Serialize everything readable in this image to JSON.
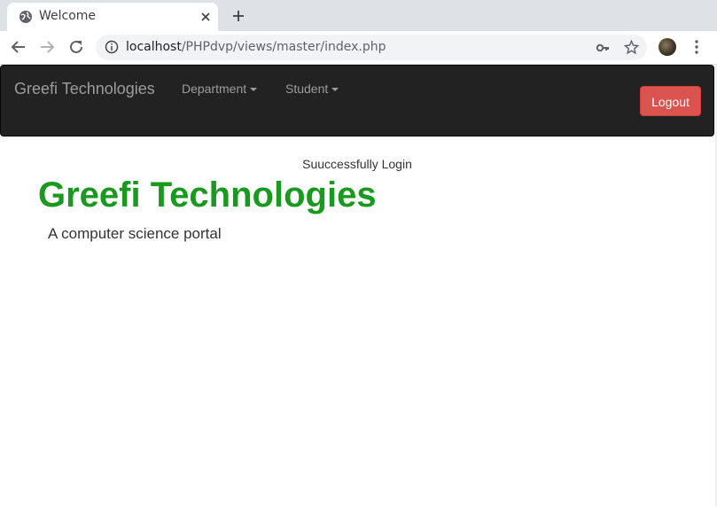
{
  "browser": {
    "tab_title": "Welcome",
    "url_host": "localhost",
    "url_path": "/PHPdvp/views/master/index.php",
    "icons": {
      "favicon": "globe-icon",
      "tab_close": "close-icon",
      "new_tab": "plus-icon",
      "back": "back-arrow-icon",
      "forward": "forward-arrow-icon",
      "reload": "reload-icon",
      "site_info": "info-icon",
      "passwords": "key-icon",
      "bookmark": "star-icon",
      "menu": "kebab-menu-icon"
    }
  },
  "navbar": {
    "brand": "Greefi Technologies",
    "dropdowns": [
      "Department",
      "Student"
    ],
    "logout_label": "Logout"
  },
  "content": {
    "status_message": "Suuccessfully Login",
    "heading": "Greefi Technologies",
    "tagline": "A computer science portal"
  },
  "colors": {
    "navbar_bg": "#222222",
    "heading_green": "#199a1e",
    "logout_red": "#d9534f"
  }
}
